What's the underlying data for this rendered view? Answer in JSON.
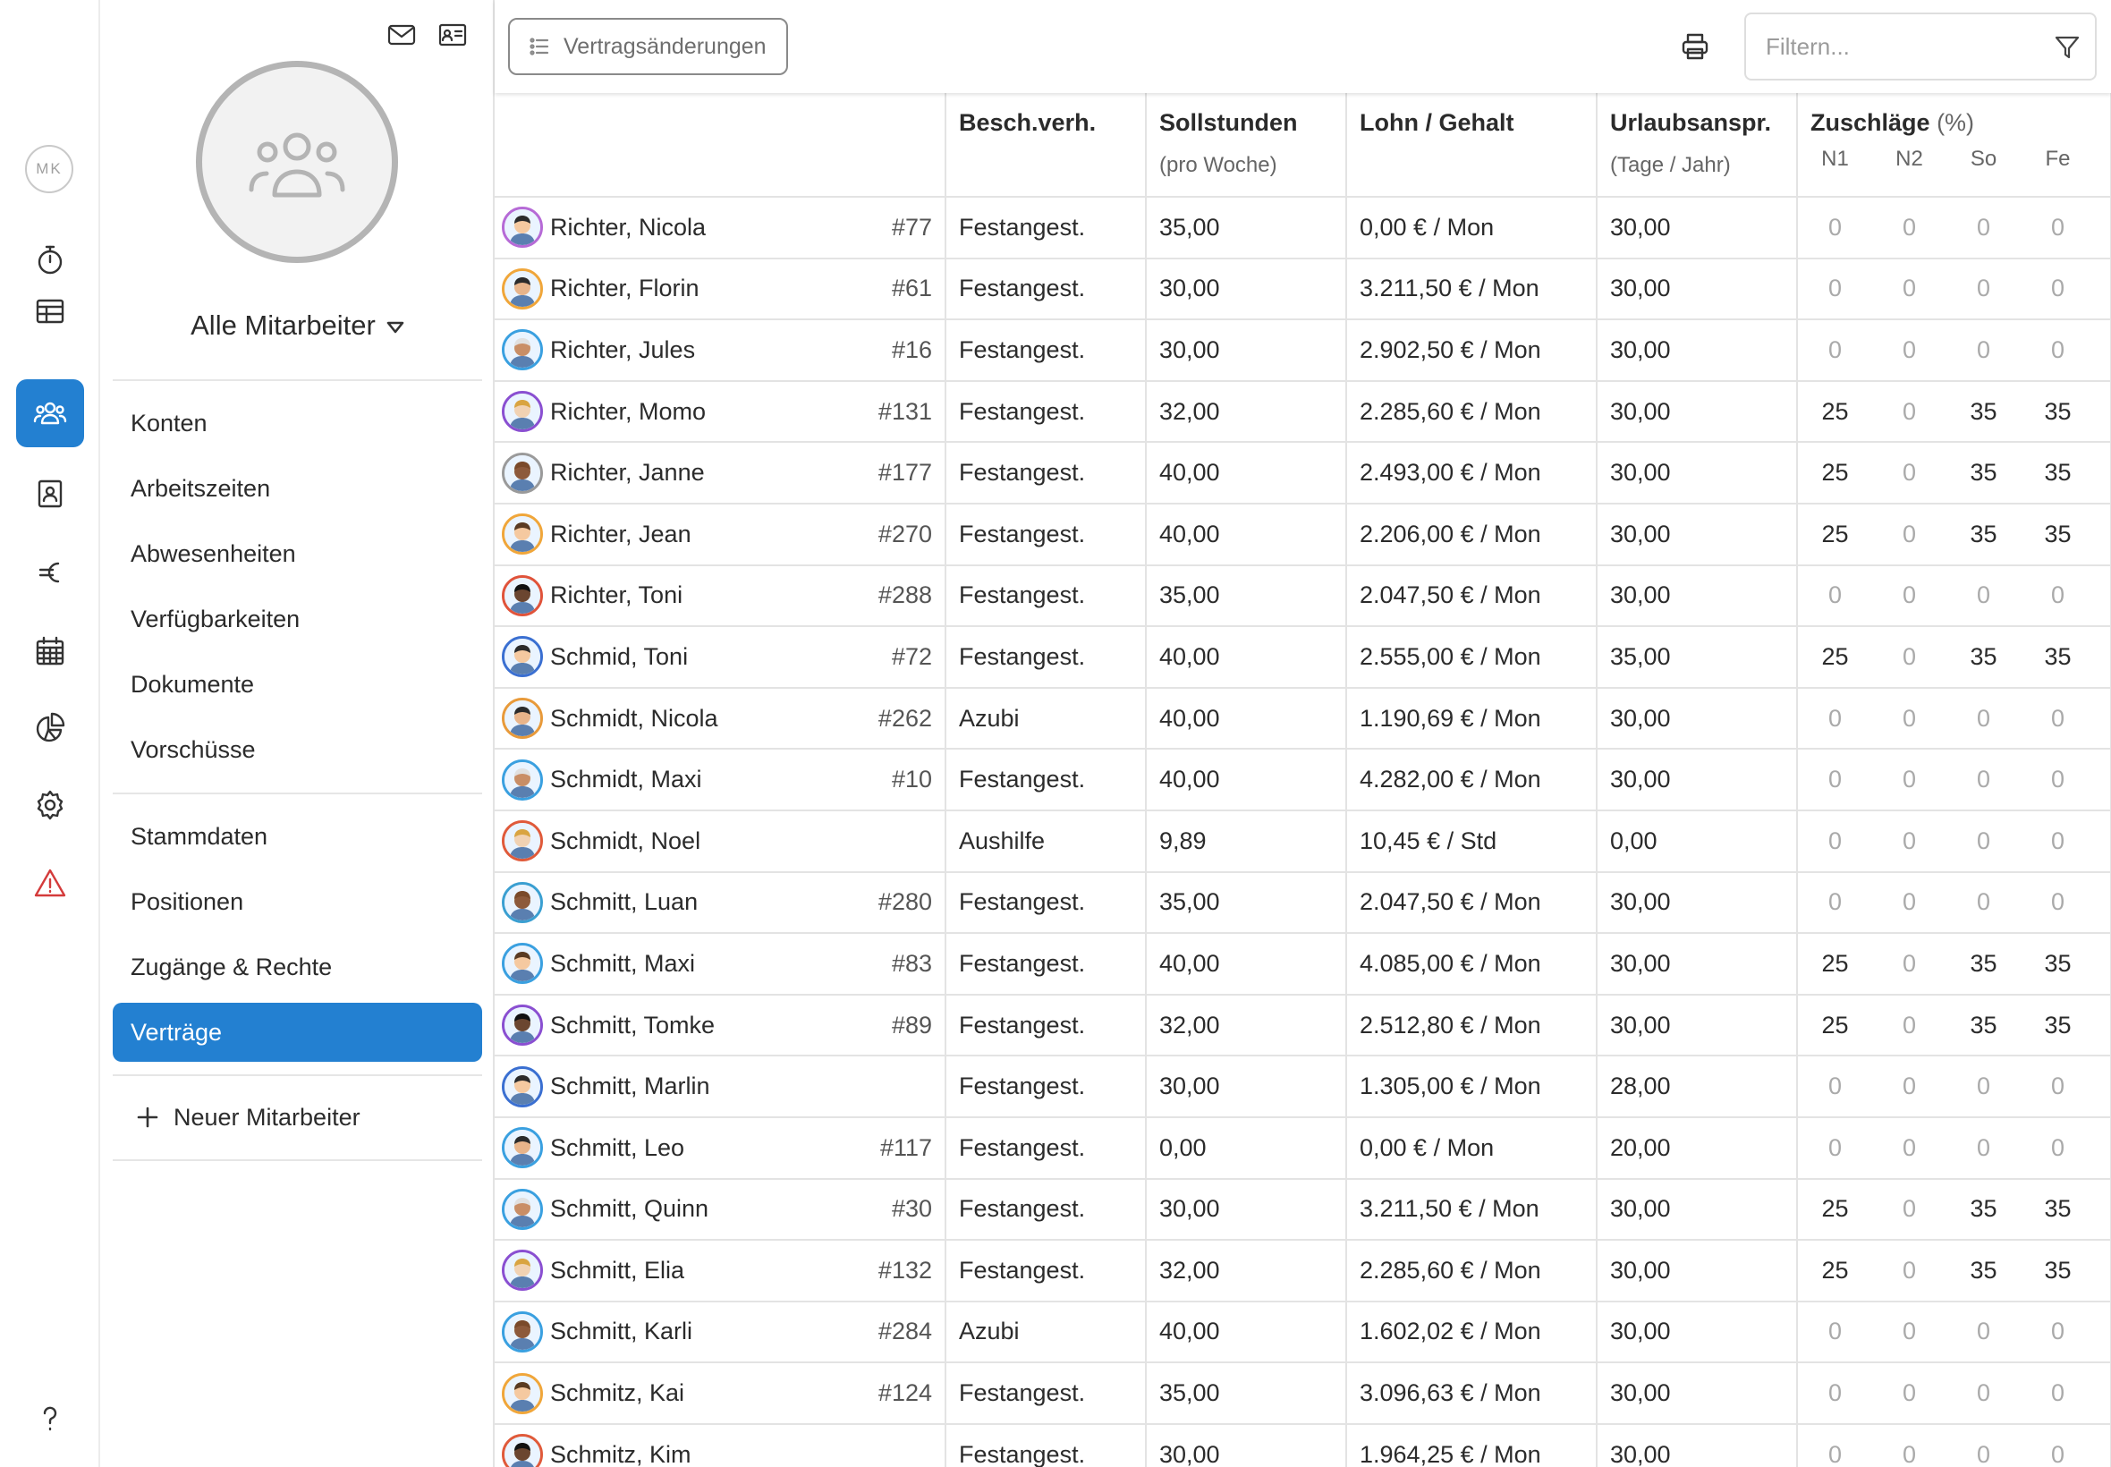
{
  "rail": {
    "user_initials": "MK",
    "items": [
      {
        "icon": "stopwatch-icon"
      },
      {
        "icon": "table-icon"
      },
      {
        "icon": "users-icon",
        "active": true
      },
      {
        "icon": "contact-card-icon"
      },
      {
        "icon": "euro-icon"
      },
      {
        "icon": "calendar-icon"
      },
      {
        "icon": "pie-chart-icon"
      },
      {
        "icon": "gear-icon"
      },
      {
        "icon": "warning-icon",
        "color": "#d43b3b"
      },
      {
        "icon": "help-icon"
      }
    ]
  },
  "panel": {
    "group_title": "Alle Mitarbeiter",
    "nav_group_1": [
      "Konten",
      "Arbeitszeiten",
      "Abwesenheiten",
      "Verfügbarkeiten",
      "Dokumente",
      "Vorschüsse"
    ],
    "nav_group_2": [
      "Stammdaten",
      "Positionen",
      "Zugänge & Rechte",
      "Verträge"
    ],
    "active_item": "Verträge",
    "new_employee_label": "Neuer Mitarbeiter"
  },
  "toolbar": {
    "contract_changes_label": "Vertragsänderungen",
    "filter_placeholder": "Filtern..."
  },
  "table": {
    "headers": {
      "employment": "Besch.verh.",
      "hours": "Sollstunden",
      "hours_sub": "(pro Woche)",
      "salary": "Lohn / Gehalt",
      "vacation": "Urlaubsanspr.",
      "vacation_sub": "(Tage / Jahr)",
      "surcharges": "Zuschläge",
      "surcharges_unit": "(%)",
      "surcharge_columns": [
        "N1",
        "N2",
        "So",
        "Fe"
      ]
    },
    "rows": [
      {
        "name": "Richter, Nicola",
        "id": "#77",
        "type": "Festangest.",
        "hours": "35,00",
        "salary": "0,00 € / Mon",
        "vacation": "30,00",
        "surcharges": [
          "0",
          "0",
          "0",
          "0"
        ]
      },
      {
        "name": "Richter, Florin",
        "id": "#61",
        "type": "Festangest.",
        "hours": "30,00",
        "salary": "3.211,50 € / Mon",
        "vacation": "30,00",
        "surcharges": [
          "0",
          "0",
          "0",
          "0"
        ]
      },
      {
        "name": "Richter, Jules",
        "id": "#16",
        "type": "Festangest.",
        "hours": "30,00",
        "salary": "2.902,50 € / Mon",
        "vacation": "30,00",
        "surcharges": [
          "0",
          "0",
          "0",
          "0"
        ]
      },
      {
        "name": "Richter, Momo",
        "id": "#131",
        "type": "Festangest.",
        "hours": "32,00",
        "salary": "2.285,60 € / Mon",
        "vacation": "30,00",
        "surcharges": [
          "25",
          "0",
          "35",
          "35"
        ]
      },
      {
        "name": "Richter, Janne",
        "id": "#177",
        "type": "Festangest.",
        "hours": "40,00",
        "salary": "2.493,00 € / Mon",
        "vacation": "30,00",
        "surcharges": [
          "25",
          "0",
          "35",
          "35"
        ]
      },
      {
        "name": "Richter, Jean",
        "id": "#270",
        "type": "Festangest.",
        "hours": "40,00",
        "salary": "2.206,00 € / Mon",
        "vacation": "30,00",
        "surcharges": [
          "25",
          "0",
          "35",
          "35"
        ]
      },
      {
        "name": "Richter, Toni",
        "id": "#288",
        "type": "Festangest.",
        "hours": "35,00",
        "salary": "2.047,50 € / Mon",
        "vacation": "30,00",
        "surcharges": [
          "0",
          "0",
          "0",
          "0"
        ]
      },
      {
        "name": "Schmid, Toni",
        "id": "#72",
        "type": "Festangest.",
        "hours": "40,00",
        "salary": "2.555,00 € / Mon",
        "vacation": "35,00",
        "surcharges": [
          "25",
          "0",
          "35",
          "35"
        ]
      },
      {
        "name": "Schmidt, Nicola",
        "id": "#262",
        "type": "Azubi",
        "hours": "40,00",
        "salary": "1.190,69 € / Mon",
        "vacation": "30,00",
        "surcharges": [
          "0",
          "0",
          "0",
          "0"
        ]
      },
      {
        "name": "Schmidt, Maxi",
        "id": "#10",
        "type": "Festangest.",
        "hours": "40,00",
        "salary": "4.282,00 € / Mon",
        "vacation": "30,00",
        "surcharges": [
          "0",
          "0",
          "0",
          "0"
        ]
      },
      {
        "name": "Schmidt, Noel",
        "id": "",
        "type": "Aushilfe",
        "hours": "9,89",
        "salary": "10,45 € / Std",
        "vacation": "0,00",
        "surcharges": [
          "0",
          "0",
          "0",
          "0"
        ]
      },
      {
        "name": "Schmitt, Luan",
        "id": "#280",
        "type": "Festangest.",
        "hours": "35,00",
        "salary": "2.047,50 € / Mon",
        "vacation": "30,00",
        "surcharges": [
          "0",
          "0",
          "0",
          "0"
        ]
      },
      {
        "name": "Schmitt, Maxi",
        "id": "#83",
        "type": "Festangest.",
        "hours": "40,00",
        "salary": "4.085,00 € / Mon",
        "vacation": "30,00",
        "surcharges": [
          "25",
          "0",
          "35",
          "35"
        ]
      },
      {
        "name": "Schmitt, Tomke",
        "id": "#89",
        "type": "Festangest.",
        "hours": "32,00",
        "salary": "2.512,80 € / Mon",
        "vacation": "30,00",
        "surcharges": [
          "25",
          "0",
          "35",
          "35"
        ]
      },
      {
        "name": "Schmitt, Marlin",
        "id": "",
        "type": "Festangest.",
        "hours": "30,00",
        "salary": "1.305,00 € / Mon",
        "vacation": "28,00",
        "surcharges": [
          "0",
          "0",
          "0",
          "0"
        ]
      },
      {
        "name": "Schmitt, Leo",
        "id": "#117",
        "type": "Festangest.",
        "hours": "0,00",
        "salary": "0,00 € / Mon",
        "vacation": "20,00",
        "surcharges": [
          "0",
          "0",
          "0",
          "0"
        ]
      },
      {
        "name": "Schmitt, Quinn",
        "id": "#30",
        "type": "Festangest.",
        "hours": "30,00",
        "salary": "3.211,50 € / Mon",
        "vacation": "30,00",
        "surcharges": [
          "25",
          "0",
          "35",
          "35"
        ]
      },
      {
        "name": "Schmitt, Elia",
        "id": "#132",
        "type": "Festangest.",
        "hours": "32,00",
        "salary": "2.285,60 € / Mon",
        "vacation": "30,00",
        "surcharges": [
          "25",
          "0",
          "35",
          "35"
        ]
      },
      {
        "name": "Schmitt, Karli",
        "id": "#284",
        "type": "Azubi",
        "hours": "40,00",
        "salary": "1.602,02 € / Mon",
        "vacation": "30,00",
        "surcharges": [
          "0",
          "0",
          "0",
          "0"
        ]
      },
      {
        "name": "Schmitz, Kai",
        "id": "#124",
        "type": "Festangest.",
        "hours": "35,00",
        "salary": "3.096,63 € / Mon",
        "vacation": "30,00",
        "surcharges": [
          "0",
          "0",
          "0",
          "0"
        ]
      },
      {
        "name": "Schmitz, Kim",
        "id": "",
        "type": "Festangest.",
        "hours": "30,00",
        "salary": "1.964,25 € / Mon",
        "vacation": "30,00",
        "surcharges": [
          "0",
          "0",
          "0",
          "0"
        ]
      }
    ]
  },
  "colors": {
    "accent": "#2380d1",
    "warning": "#d43b3b",
    "avatar_ring_colors": [
      "#b66ad6",
      "#f0a63a",
      "#3aa0e0",
      "#8a4fd1",
      "#9a9a9a",
      "#f0a63a",
      "#e0533a",
      "#3a6fd1",
      "#e89a3a",
      "#3aa0e0",
      "#e05a3a",
      "#3a9fd1",
      "#3aa0e0",
      "#8a4fd1",
      "#3a6fd1",
      "#3aa0e0",
      "#3aa0e0",
      "#8a4fd1",
      "#3aa0e0",
      "#f0a63a",
      "#e05a3a"
    ]
  }
}
